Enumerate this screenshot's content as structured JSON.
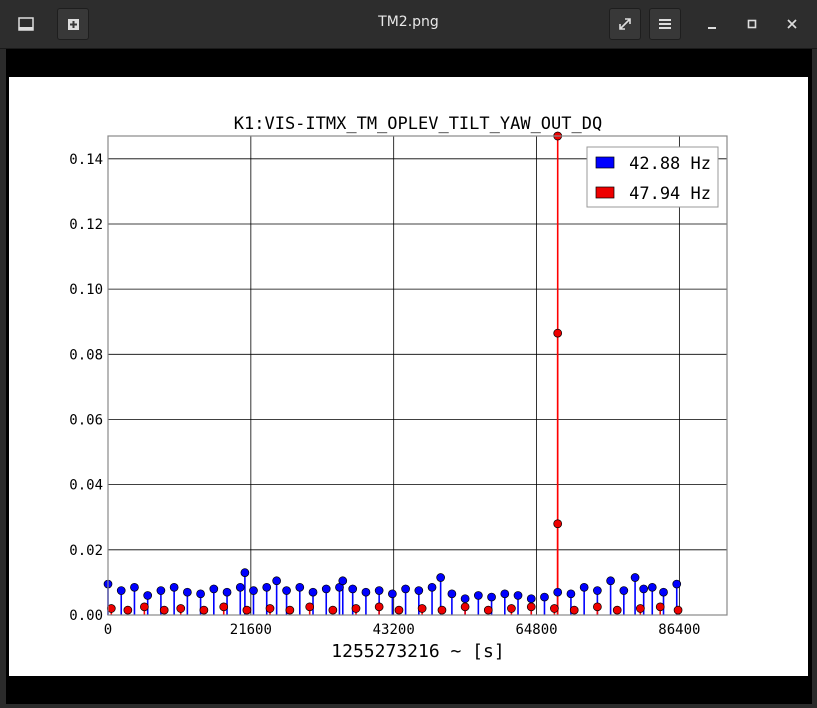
{
  "window": {
    "title": "TM2.png",
    "buttons": {
      "left_icon": "image-icon",
      "new": "new-tab-icon",
      "fullscreen": "fullscreen-icon",
      "menu": "menu-icon",
      "minimize": "minimize-icon",
      "maximize": "maximize-icon",
      "close": "close-icon"
    }
  },
  "chart_data": {
    "type": "scatter",
    "title": "K1:VIS-ITMX_TM_OPLEV_TILT_YAW_OUT_DQ",
    "xlabel": "1255273216 ~ [s]",
    "ylabel": "",
    "xlim": [
      0,
      93600
    ],
    "ylim": [
      0,
      0.147
    ],
    "x_ticks": [
      "0",
      "21600",
      "43200",
      "64800",
      "86400"
    ],
    "x_tick_values": [
      0,
      21600,
      43200,
      64800,
      86400
    ],
    "y_ticks": [
      "0.00",
      "0.02",
      "0.04",
      "0.06",
      "0.08",
      "0.10",
      "0.12",
      "0.14"
    ],
    "y_tick_values": [
      0,
      0.02,
      0.04,
      0.06,
      0.08,
      0.1,
      0.12,
      0.14
    ],
    "grid": true,
    "legend_position": "top-right",
    "series": [
      {
        "name": "42.88 Hz",
        "color": "#0000ff",
        "marker": "circle-stem",
        "x": [
          0,
          2000,
          4000,
          6000,
          8000,
          10000,
          12000,
          14000,
          16000,
          18000,
          20000,
          20700,
          22000,
          24000,
          25500,
          27000,
          29000,
          31000,
          33000,
          35000,
          35500,
          37000,
          39000,
          41000,
          43000,
          45000,
          47000,
          49000,
          50300,
          52000,
          54000,
          56000,
          58000,
          60000,
          62000,
          64000,
          66000,
          68000,
          70000,
          72000,
          74000,
          76000,
          78000,
          79700,
          81000,
          82300,
          84000,
          86000
        ],
        "y": [
          0.0095,
          0.0075,
          0.0085,
          0.006,
          0.0075,
          0.0085,
          0.007,
          0.0065,
          0.008,
          0.007,
          0.0085,
          0.013,
          0.0075,
          0.0085,
          0.0105,
          0.0075,
          0.0085,
          0.007,
          0.008,
          0.0085,
          0.0105,
          0.008,
          0.007,
          0.0075,
          0.0065,
          0.008,
          0.0075,
          0.0085,
          0.0115,
          0.0065,
          0.005,
          0.006,
          0.0055,
          0.0065,
          0.006,
          0.005,
          0.0055,
          0.007,
          0.0065,
          0.0085,
          0.0075,
          0.0105,
          0.0075,
          0.0115,
          0.008,
          0.0085,
          0.007,
          0.0095
        ]
      },
      {
        "name": "47.94 Hz",
        "color": "#ff0000",
        "marker": "circle-stem",
        "x": [
          500,
          3000,
          5500,
          8500,
          11000,
          14500,
          17500,
          21000,
          24500,
          27500,
          30500,
          34000,
          37500,
          41000,
          44000,
          47500,
          50500,
          54000,
          57500,
          61000,
          64000,
          67500,
          68000,
          68000,
          68000,
          70500,
          74000,
          77000,
          80500,
          83500,
          86200
        ],
        "y": [
          0.002,
          0.0015,
          0.0025,
          0.0015,
          0.002,
          0.0015,
          0.0025,
          0.0015,
          0.002,
          0.0015,
          0.0025,
          0.0015,
          0.002,
          0.0025,
          0.0015,
          0.002,
          0.0015,
          0.0025,
          0.0015,
          0.002,
          0.0025,
          0.002,
          0.028,
          0.0865,
          0.147,
          0.0015,
          0.0025,
          0.0015,
          0.002,
          0.0025,
          0.0015
        ]
      }
    ]
  }
}
